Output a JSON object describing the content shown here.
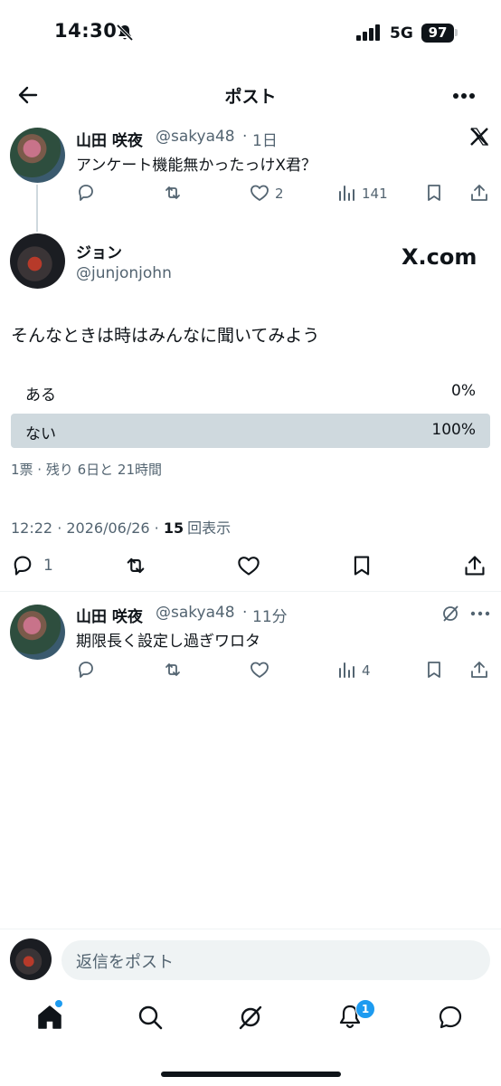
{
  "status_bar": {
    "time": "14:30",
    "network": "5G",
    "battery": "97"
  },
  "header": {
    "title": "ポスト"
  },
  "parent_post": {
    "name": "山田 咲夜",
    "handle": "@sakya48",
    "time": "1日",
    "text": "アンケート機能無かったっけX君？",
    "likes": "2",
    "views": "141"
  },
  "main_post": {
    "name": "ジョン",
    "handle": "@junjonjohn",
    "brand": "X.com",
    "text": "そんなときは時はみんなに聞いてみよう",
    "poll": {
      "options": [
        {
          "label": "ある",
          "percent": "0%",
          "fill": 0
        },
        {
          "label": "ない",
          "percent": "100%",
          "fill": 1
        }
      ],
      "meta": "1票 · 残り 6日と 21時間"
    },
    "timestamp": "12:22 · 2026/06/26 · ",
    "views_count": "15",
    "views_label": "回表示",
    "reply_count": "1"
  },
  "reply_post": {
    "name": "山田 咲夜",
    "handle": "@sakya48",
    "time": "11分",
    "text": "期限長く設定し過ぎワロタ",
    "views": "4"
  },
  "composer": {
    "placeholder": "返信をポスト"
  },
  "bottom_nav": {
    "notification_count": "1"
  },
  "colors": {
    "accent": "#1d9bf0",
    "poll_fill": "#cfd9de",
    "text": "#0f1419",
    "muted": "#536471"
  }
}
